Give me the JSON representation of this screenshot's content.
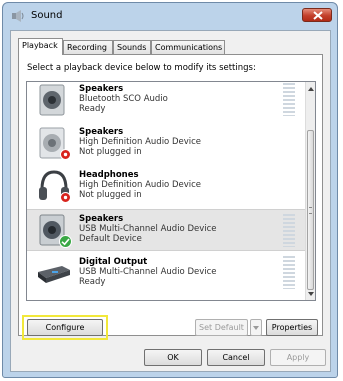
{
  "window": {
    "title": "Sound"
  },
  "tabs": [
    {
      "label": "Playback",
      "active": true
    },
    {
      "label": "Recording",
      "active": false
    },
    {
      "label": "Sounds",
      "active": false
    },
    {
      "label": "Communications",
      "active": false
    }
  ],
  "instruction": "Select a playback device below to modify its settings:",
  "devices": [
    {
      "name": "Speakers",
      "description": "Bluetooth SCO Audio",
      "status": "Ready",
      "icon": "speaker-icon",
      "badge": "none"
    },
    {
      "name": "Speakers",
      "description": "High Definition Audio Device",
      "status": "Not plugged in",
      "icon": "speaker-icon",
      "badge": "not-plugged"
    },
    {
      "name": "Headphones",
      "description": "High Definition Audio Device",
      "status": "Not plugged in",
      "icon": "headphones-icon",
      "badge": "not-plugged"
    },
    {
      "name": "Speakers",
      "description": "USB Multi-Channel Audio Device",
      "status": "Default Device",
      "icon": "speaker-icon",
      "badge": "default",
      "selected": true
    },
    {
      "name": "Digital Output",
      "description": "USB Multi-Channel Audio Device",
      "status": "Ready",
      "icon": "digital-output-icon",
      "badge": "none"
    }
  ],
  "buttons": {
    "configure": "Configure",
    "set_default": "Set Default",
    "properties": "Properties",
    "ok": "OK",
    "cancel": "Cancel",
    "apply": "Apply"
  },
  "colors": {
    "highlight": "#f2e83a",
    "default_badge": "#3aa845",
    "not_plugged_badge": "#d8231d"
  }
}
